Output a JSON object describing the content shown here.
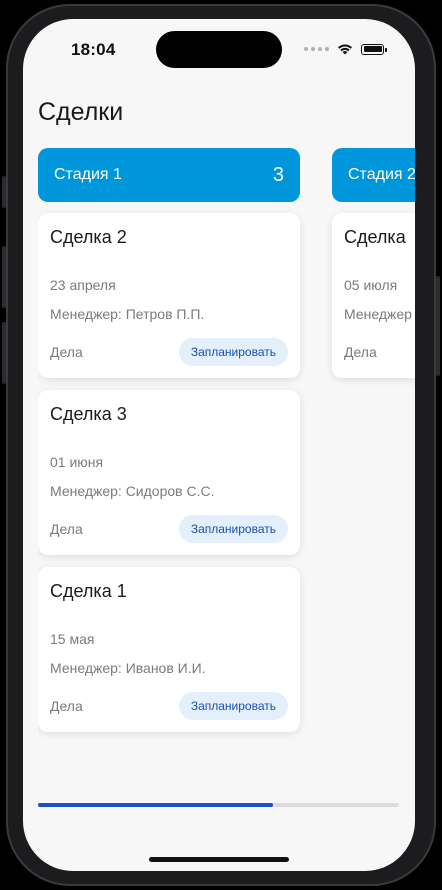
{
  "status_bar": {
    "time": "18:04",
    "icons": [
      "signal-dots-icon",
      "wifi-icon",
      "battery-icon"
    ]
  },
  "page": {
    "title": "Сделки"
  },
  "stages": [
    {
      "name": "Стадия 1",
      "count": "3",
      "deals": [
        {
          "title": "Сделка 2",
          "date": "23 апреля",
          "manager": "Менеджер: Петров П.П.",
          "tasks_label": "Дела",
          "action_label": "Запланировать"
        },
        {
          "title": "Сделка 3",
          "date": "01 июня",
          "manager": "Менеджер: Сидоров С.С.",
          "tasks_label": "Дела",
          "action_label": "Запланировать"
        },
        {
          "title": "Сделка 1",
          "date": "15 мая",
          "manager": "Менеджер: Иванов И.И.",
          "tasks_label": "Дела",
          "action_label": "Запланировать"
        }
      ]
    },
    {
      "name": "Стадия 2",
      "deals": [
        {
          "title": "Сделка",
          "date": "05 июля",
          "manager": "Менеджер",
          "tasks_label": "Дела"
        }
      ]
    }
  ],
  "scroll": {
    "position_fraction": 0.65
  },
  "colors": {
    "stage_header": "#0096dc",
    "action_button_bg": "#e3f0fc",
    "action_button_text": "#1a4fb0",
    "scroll_thumb": "#1a4fc8"
  }
}
